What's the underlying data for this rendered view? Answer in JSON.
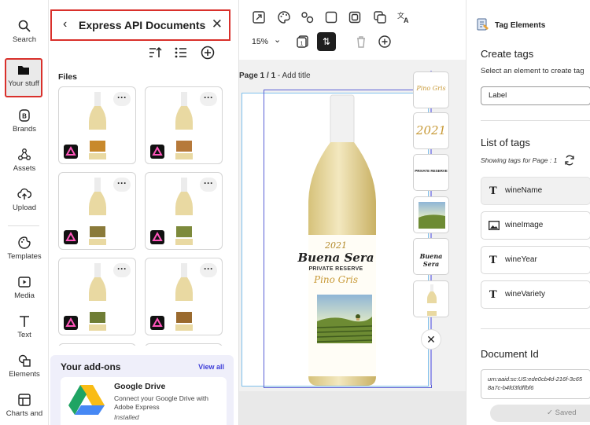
{
  "rail": {
    "search": "Search",
    "your_stuff": "Your stuff",
    "brands": "Brands",
    "assets": "Assets",
    "upload": "Upload",
    "templates": "Templates",
    "media": "Media",
    "text": "Text",
    "elements": "Elements",
    "charts": "Charts and"
  },
  "panel": {
    "title": "Express API Documents",
    "files_label": "Files",
    "addons": {
      "heading": "Your add-ons",
      "view_all": "View all",
      "item_name": "Google Drive",
      "item_desc": "Connect your Google Drive with Adobe Express",
      "item_status": "Installed"
    }
  },
  "toolbar": {
    "zoom": "15%"
  },
  "canvas": {
    "page_label": "Page 1 / 1",
    "add_title": "Add title"
  },
  "label": {
    "year": "2021",
    "name": "Buena Sera",
    "reserve": "PRIVATE RESERVE",
    "variety": "Pino Gris"
  },
  "layers": {
    "l1": "Pino Gris",
    "l2": "2021",
    "l3": "PRIVATE RESERVE",
    "l5": "Buena Sera"
  },
  "right": {
    "title": "Tag Elements",
    "create_h": "Create tags",
    "create_sub": "Select an element to create tag",
    "label_field": "Label",
    "list_h": "List of tags",
    "showing": "Showing tags for Page : 1",
    "tags": [
      "wineName",
      "wineImage",
      "wineYear",
      "wineVariety"
    ],
    "docid_h": "Document Id",
    "docid_line1": "urn:aaid:sc:US:ede0cb4d-216f-3c65",
    "docid_line2": "8a7c-b4fd3fdffbf6",
    "saved": "Saved"
  }
}
